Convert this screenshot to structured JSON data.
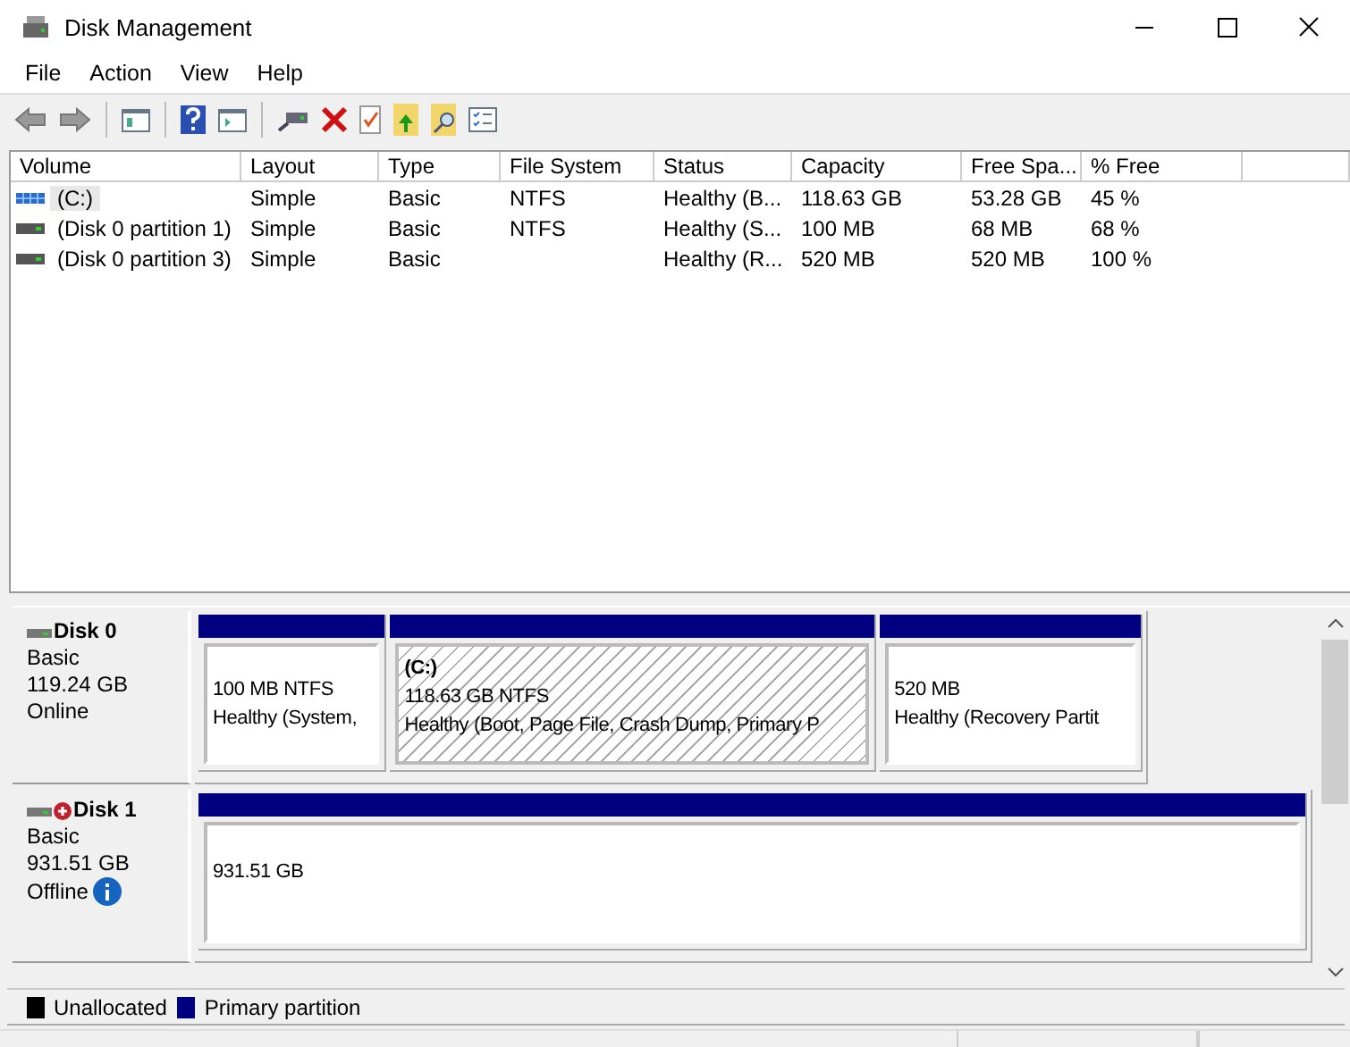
{
  "window": {
    "title": "Disk Management"
  },
  "menu": [
    "File",
    "Action",
    "View",
    "Help"
  ],
  "table": {
    "columns": [
      "Volume",
      "Layout",
      "Type",
      "File System",
      "Status",
      "Capacity",
      "Free Spa...",
      "% Free"
    ],
    "rows": [
      {
        "kind": "volume",
        "cells": [
          "(C:)",
          "Simple",
          "Basic",
          "NTFS",
          "Healthy (B...",
          "118.63 GB",
          "53.28 GB",
          "45 %"
        ],
        "selected": true
      },
      {
        "kind": "drive",
        "cells": [
          "(Disk 0 partition 1)",
          "Simple",
          "Basic",
          "NTFS",
          "Healthy (S...",
          "100 MB",
          "68 MB",
          "68 %"
        ],
        "selected": false
      },
      {
        "kind": "drive",
        "cells": [
          "(Disk 0 partition 3)",
          "Simple",
          "Basic",
          "",
          "Healthy (R...",
          "520 MB",
          "520 MB",
          "100 %"
        ],
        "selected": false
      }
    ]
  },
  "disks": [
    {
      "name": "Disk 0",
      "type": "Basic",
      "size": "119.24 GB",
      "status": "Online",
      "offline": false,
      "partitions": [
        {
          "size": "100 MB NTFS",
          "status": "Healthy (System,",
          "selected": false
        },
        {
          "label": "(C:)",
          "size": "118.63 GB NTFS",
          "status": "Healthy (Boot, Page File, Crash Dump, Primary P",
          "selected": true
        },
        {
          "size": "520 MB",
          "status": "Healthy (Recovery Partit",
          "selected": false
        }
      ]
    },
    {
      "name": "Disk 1",
      "type": "Basic",
      "size": "931.51 GB",
      "status": "Offline",
      "offline": true,
      "partitions": [
        {
          "size": "931.51 GB",
          "selected": false
        }
      ]
    }
  ],
  "legend": [
    {
      "label": "Unallocated",
      "color": "#000000"
    },
    {
      "label": "Primary partition",
      "color": "#000080"
    }
  ]
}
